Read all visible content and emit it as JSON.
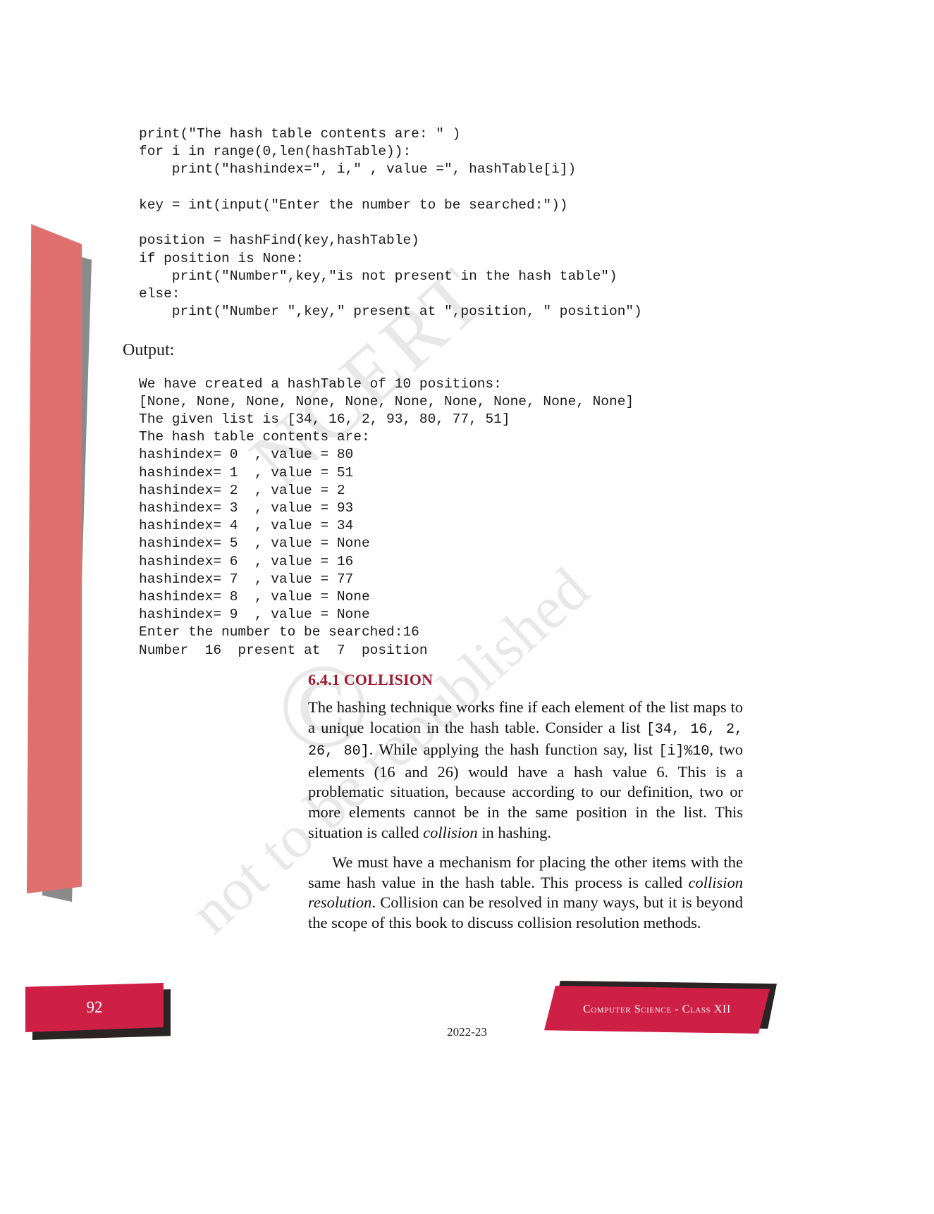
{
  "page": {
    "number": "92",
    "book_title": "Computer Science - Class XII",
    "year": "2022-23"
  },
  "watermark": {
    "ncert": "NCERT",
    "republished": "not to be republished",
    "copyright": "©"
  },
  "code": {
    "lines": "print(\"The hash table contents are: \" )\nfor i in range(0,len(hashTable)):\n    print(\"hashindex=\", i,\" , value =\", hashTable[i])\n\nkey = int(input(\"Enter the number to be searched:\"))\n\nposition = hashFind(key,hashTable)\nif position is None:\n    print(\"Number\",key,\"is not present in the hash table\")\nelse:\n    print(\"Number \",key,\" present at \",position, \" position\")"
  },
  "output": {
    "label": "Output:",
    "lines": "We have created a hashTable of 10 positions:\n[None, None, None, None, None, None, None, None, None, None]\nThe given list is [34, 16, 2, 93, 80, 77, 51]\nThe hash table contents are:\nhashindex= 0  , value = 80\nhashindex= 1  , value = 51\nhashindex= 2  , value = 2\nhashindex= 3  , value = 93\nhashindex= 4  , value = 34\nhashindex= 5  , value = None\nhashindex= 6  , value = 16\nhashindex= 7  , value = 77\nhashindex= 8  , value = None\nhashindex= 9  , value = None\nEnter the number to be searched:16\nNumber  16  present at  7  position"
  },
  "section": {
    "heading": "6.4.1 COLLISION",
    "heading_color": "#9e1b32",
    "paragraph1": {
      "part1": "The hashing technique works fine if each element of the list maps to a unique location in the hash table. Consider a list ",
      "code1": "[34, 16, 2, 26, 80]",
      "part2": ". While applying the hash function say, list ",
      "code2": "[i]%10",
      "part3": ", two elements (16 and 26) would have a hash value 6. This is a problematic situation, because according to our definition, two or more elements cannot be in the same position in the list. This situation is called ",
      "italic1": "collision",
      "part4": " in hashing."
    },
    "paragraph2": {
      "part1": "We must have a mechanism for placing the other items with the same hash value in the hash table. This process is called ",
      "italic1": "collision resolution",
      "part2": ". Collision can be resolved in many ways, but it is beyond the scope of this book to discuss collision resolution methods."
    }
  },
  "colors": {
    "crimson": "#ce1f45",
    "salmon_bar": "#e0706e",
    "gray_bar": "#8a8a8a",
    "heading_red": "#9e1b32"
  }
}
